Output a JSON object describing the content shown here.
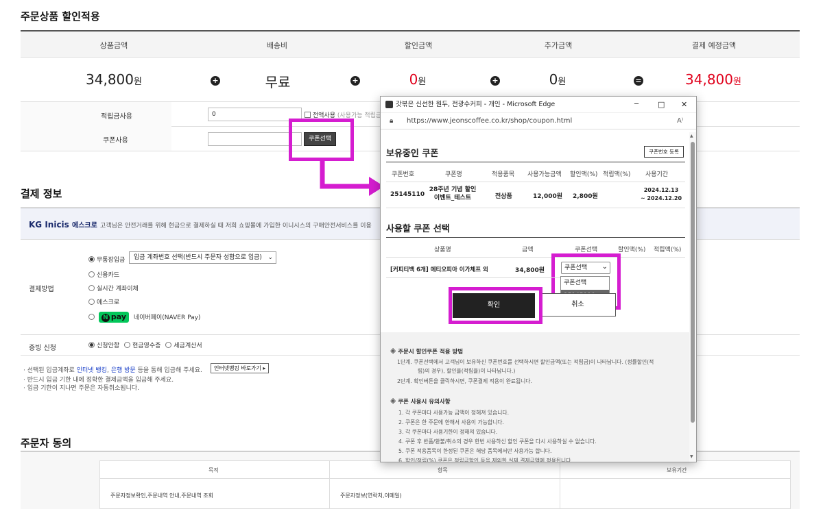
{
  "order_discount": {
    "title": "주문상품 할인적용",
    "headers": [
      "상품금액",
      "배송비",
      "할인금액",
      "추가금액",
      "결제 예정금액"
    ],
    "amounts": [
      {
        "value": "34,800",
        "unit": "원"
      },
      {
        "value": "무료",
        "unit": ""
      },
      {
        "value": "0",
        "unit": "원"
      },
      {
        "value": "0",
        "unit": "원"
      },
      {
        "value": "34,800",
        "unit": "원"
      }
    ],
    "operators": [
      "+",
      "+",
      "+",
      "="
    ],
    "points_label": "적립금사용",
    "points_value": "0",
    "use_all_label": "전액사용",
    "use_all_note": "(사용가능 적립금",
    "coupon_label": "쿠폰사용",
    "coupon_select_button": "쿠폰선택"
  },
  "payment": {
    "title": "결제 정보",
    "kg_logo": "KG Inicis",
    "kg_escrow": "에스크로",
    "kg_notice": "고객님은 안전거래를 위해 현금으로 결제하실 때 저희 쇼핑몰에 가입한 이니시스의 구매안전서비스를 이용",
    "method_label": "결제방법",
    "methods": [
      "무통장입금",
      "신용카드",
      "실시간 계좌이체",
      "에스크로",
      "네이버페이(NAVER Pay)"
    ],
    "account_select": "입금 계좌번호 선택(반드시 주문자 성함으로 입금)",
    "npay_label": "pay",
    "receipt_label": "증빙 신청",
    "receipt_options": [
      "신청안함",
      "현금영수증",
      "세금계산서"
    ],
    "notes": {
      "line1_prefix": "· 선택된 입금계좌로",
      "line1_link1": "인터넷 뱅킹",
      "line1_link2": "은행 방문",
      "line1_suffix": "등을 통해 입금해 주세요.",
      "bank_button": "인터넷뱅킹 바로가기 ▸",
      "line2": "· 반드시 입금 기한 내에 정확한 결제금액을 입금해 주세요.",
      "line3": "· 입금 기한이 지나면 주문은 자동취소됩니다."
    }
  },
  "consent": {
    "title": "주문자 동의",
    "headers": [
      "목적",
      "항목",
      "보유기간"
    ],
    "row": [
      "주문자정보확인,주문내역 안내,주문내역 조회",
      "주문자정보(연락처,이메일)",
      ""
    ]
  },
  "popup": {
    "window_title": "갓볶은 신선한 원두, 전광수커피 - 개인 - Microsoft Edge",
    "url": "https://www.jeonscoffee.co.kr/shop/coupon.html",
    "held_title": "보유중인 쿠폰",
    "register_button": "쿠폰번호 등록",
    "held_headers": [
      "쿠폰번호",
      "쿠폰명",
      "적용품목",
      "사용가능금액",
      "할인액(%)",
      "적립액(%)",
      "사용기간"
    ],
    "held_row": {
      "number": "25145110",
      "name_line1": "28주년 기념 할인",
      "name_line2": "이벤트_테스트",
      "scope": "전상품",
      "min_amount": "12,000원",
      "discount": "2,800원",
      "points": "",
      "period_line1": "2024.12.13",
      "period_line2": "~ 2024.12.20"
    },
    "select_title": "사용할 쿠폰 선택",
    "select_headers": [
      "상품명",
      "금액",
      "쿠폰선택",
      "할인액(%)",
      "적립액(%)"
    ],
    "select_row": {
      "product": "[커피티백 6개] 에티오피아 이가체프 외",
      "price": "34,800원",
      "select_value": "쿠폰선택"
    },
    "dropdown_options": [
      "쿠폰선택",
      "25145110"
    ],
    "confirm_button": "확인",
    "cancel_button": "취소",
    "guide_title": "※ 주문시 할인쿠폰 적용 방법",
    "guide_lines": [
      "1단계. 쿠폰선택에서 고객님이 보유하신 쿠폰번호를 선택하시면 할인금액(또는 적립금)이 나타납니다. (정률할인(적",
      "립)의 경우), 할인율(적립율)이 나타납니다.)",
      "2단계. 확인버튼을 클릭하시면, 쿠폰결제 적용이 완료됩니다."
    ],
    "caution_title": "※ 쿠폰 사용시 유의사항",
    "caution_lines": [
      "1. 각 쿠폰마다 사용가능 금액이 정해져 있습니다.",
      "2. 쿠폰은 한 주문에 한해서 사용이 가능합니다.",
      "3. 각 쿠폰마다 사용기한이 정해져 있습니다.",
      "4. 쿠폰 후 반품/환불/취소의 경우 한번 사용하신 할인 쿠폰을 다시 사용하실 수 없습니다.",
      "5. 쿠폰 적용품목이 한정된 쿠폰은 해당 품목에서만 사용가능 합니다.",
      "6. 할인/적립(%) 쿠폰은 적립금할인 등을 제외한 실제 결제금액에 적용됩니다."
    ],
    "window_buttons": [
      "─",
      "□",
      "✕"
    ]
  },
  "colors": {
    "highlight": "#d51dd0",
    "price_red": "#e0001b",
    "npay_green": "#03c75a"
  }
}
